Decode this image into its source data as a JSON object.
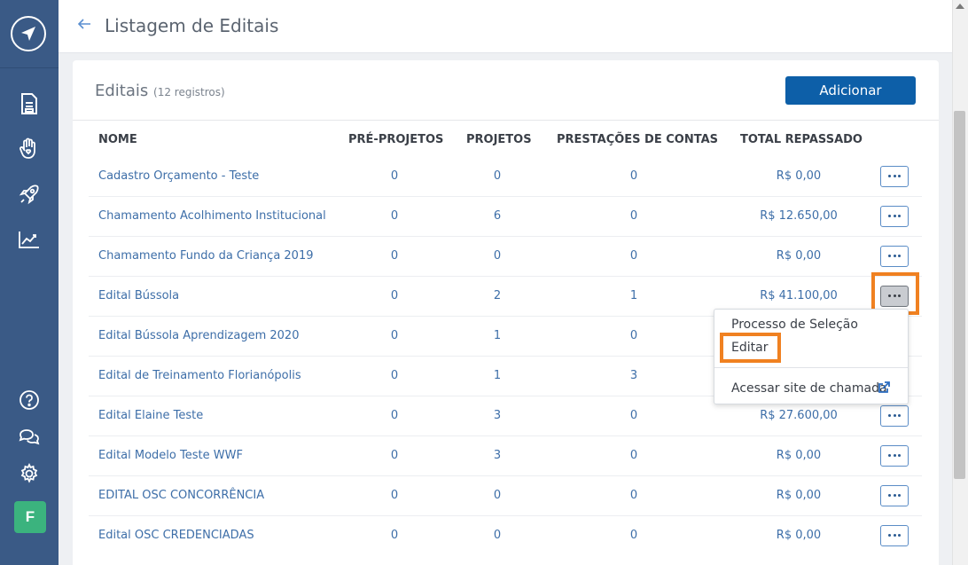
{
  "header": {
    "title": "Listagem de Editais"
  },
  "card": {
    "title": "Editais",
    "count": "(12 registros)",
    "add_label": "Adicionar"
  },
  "table": {
    "columns": [
      "NOME",
      "PRÉ-PROJETOS",
      "PROJETOS",
      "PRESTAÇÕES DE CONTAS",
      "TOTAL REPASSADO"
    ],
    "rows": [
      {
        "name": "Cadastro Orçamento - Teste",
        "pre": "0",
        "proj": "0",
        "prest": "0",
        "total": "R$ 0,00"
      },
      {
        "name": "Chamamento Acolhimento Institucional",
        "pre": "0",
        "proj": "6",
        "prest": "0",
        "total": "R$ 12.650,00"
      },
      {
        "name": "Chamamento Fundo da Criança 2019",
        "pre": "0",
        "proj": "0",
        "prest": "0",
        "total": "R$ 0,00"
      },
      {
        "name": "Edital Bússola",
        "pre": "0",
        "proj": "2",
        "prest": "1",
        "total": "R$ 41.100,00"
      },
      {
        "name": "Edital Bússola Aprendizagem 2020",
        "pre": "0",
        "proj": "1",
        "prest": "0",
        "total": ""
      },
      {
        "name": "Edital de Treinamento Florianópolis",
        "pre": "0",
        "proj": "1",
        "prest": "3",
        "total": ""
      },
      {
        "name": "Edital Elaine Teste",
        "pre": "0",
        "proj": "3",
        "prest": "0",
        "total": "R$ 27.600,00"
      },
      {
        "name": "Edital Modelo Teste WWF",
        "pre": "0",
        "proj": "3",
        "prest": "0",
        "total": "R$ 0,00"
      },
      {
        "name": "EDITAL OSC CONCORRÊNCIA",
        "pre": "0",
        "proj": "0",
        "prest": "0",
        "total": "R$ 0,00"
      },
      {
        "name": "Edital OSC CREDENCIADAS",
        "pre": "0",
        "proj": "0",
        "prest": "0",
        "total": "R$ 0,00"
      }
    ]
  },
  "menu": {
    "items": [
      "Processo de Seleção",
      "Editar",
      "Acessar site de chamada"
    ]
  },
  "sidebar": {
    "nav_icons": [
      "document-icon",
      "hand-heart-icon",
      "rocket-icon",
      "chart-icon"
    ],
    "bottom_icons": [
      "help-icon",
      "chat-icon",
      "settings-icon"
    ],
    "avatar": "F"
  },
  "colors": {
    "sidebar": "#3a5a86",
    "primary": "#0d5fa8",
    "link": "#3d6ea8",
    "highlight": "#f08121",
    "avatar": "#3bb37e"
  }
}
